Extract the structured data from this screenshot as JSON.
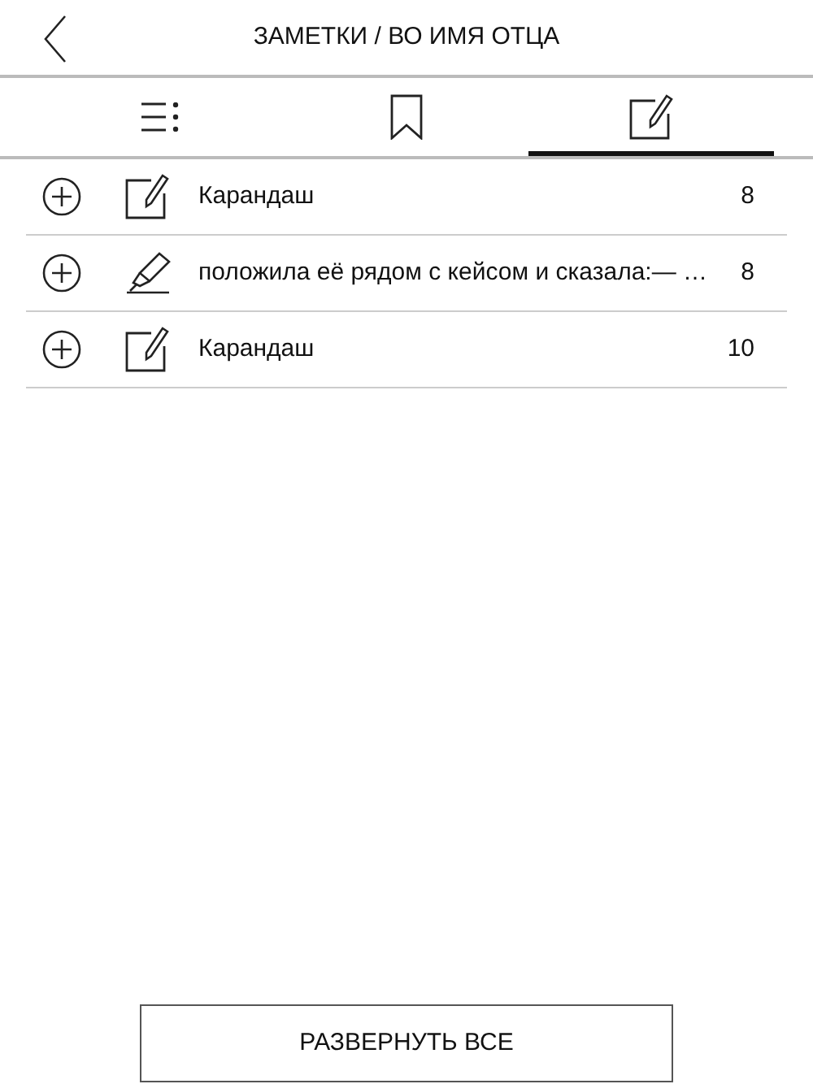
{
  "header": {
    "title": "ЗАМЕТКИ / ВО ИМЯ ОТЦА"
  },
  "tabs": [
    {
      "kind": "contents",
      "selected": false
    },
    {
      "kind": "bookmarks",
      "selected": false
    },
    {
      "kind": "notes",
      "selected": true
    }
  ],
  "items": [
    {
      "kind": "note",
      "text": "Карандаш",
      "page": "8"
    },
    {
      "kind": "highlight",
      "text": "положила её рядом с кейсом и сказала:— …",
      "page": "8"
    },
    {
      "kind": "note",
      "text": "Карандаш",
      "page": "10"
    }
  ],
  "button": {
    "label": "РАЗВЕРНУТЬ ВСЕ"
  }
}
